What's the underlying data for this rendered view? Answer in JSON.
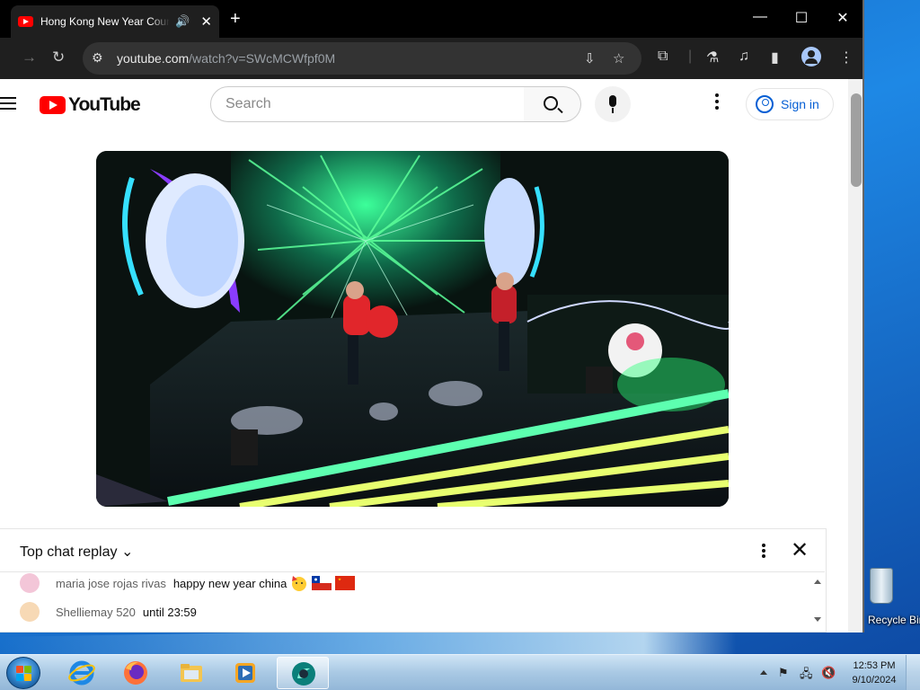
{
  "browser": {
    "tab_title": "Hong Kong New Year Countdown",
    "tab_audio_icon": "speaker-icon",
    "url_host": "youtube.com",
    "url_path": "/watch?v=SWcMCWfpf0M"
  },
  "youtube": {
    "logo_text": "YouTube",
    "search_placeholder": "Search",
    "sign_in_label": "Sign in"
  },
  "chat": {
    "header_title": "Top chat replay",
    "messages": [
      {
        "author": "maria jose rojas rivas",
        "text": "happy new year china",
        "emojis": [
          "partying-face",
          "flag-chile",
          "flag-china"
        ],
        "avatar_color": "#f3c6d8"
      },
      {
        "author": "Shelliemay 520",
        "text": "until 23:59",
        "emojis": [],
        "avatar_color": "#f7d9b5"
      }
    ]
  },
  "desktop": {
    "recycle_bin_label": "Recycle Bin"
  },
  "taskbar": {
    "apps": [
      "internet-explorer",
      "firefox",
      "file-explorer",
      "media-player",
      "browser-app"
    ],
    "clock_time": "12:53 PM",
    "clock_date": "9/10/2024"
  },
  "colors": {
    "yt_red": "#ff0000",
    "link_blue": "#065fd4",
    "chrome_dark": "#1f1f1f"
  }
}
